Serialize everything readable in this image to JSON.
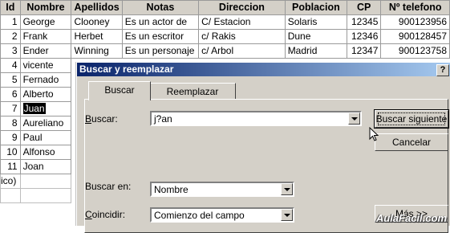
{
  "sheet": {
    "headers": [
      "Id",
      "Nombre",
      "Apellidos",
      "Notas",
      "Direccion",
      "Poblacion",
      "CP",
      "Nº telefono"
    ],
    "rows": [
      {
        "id": "1",
        "nombre": "George",
        "apellidos": "Clooney",
        "notas": "Es un actor de",
        "direccion": "C/ Estacion",
        "poblacion": "Solaris",
        "cp": "12345",
        "telefono": "900123956"
      },
      {
        "id": "2",
        "nombre": "Frank",
        "apellidos": "Herbet",
        "notas": "Es un escritor",
        "direccion": "c/ Rakis",
        "poblacion": "Dune",
        "cp": "12346",
        "telefono": "900128457"
      },
      {
        "id": "3",
        "nombre": "Ender",
        "apellidos": "Winning",
        "notas": "Es un personaje",
        "direccion": "c/ Arbol",
        "poblacion": "Madrid",
        "cp": "12347",
        "telefono": "900123758"
      },
      {
        "id": "4",
        "nombre": "vicente"
      },
      {
        "id": "5",
        "nombre": "Fernado"
      },
      {
        "id": "6",
        "nombre": "Alberto"
      },
      {
        "id": "7",
        "nombre": "Juan",
        "selected": true
      },
      {
        "id": "8",
        "nombre": "Aureliano"
      },
      {
        "id": "9",
        "nombre": "Paul"
      },
      {
        "id": "10",
        "nombre": "Alfonso"
      },
      {
        "id": "11",
        "nombre": "Joan"
      }
    ],
    "last_row_fragment": "ico)"
  },
  "dialog": {
    "title": "Buscar y reemplazar",
    "help": "?",
    "tabs": [
      "Buscar",
      "Reemplazar"
    ],
    "buscar_label_prefix": "",
    "buscar_label_ul": "B",
    "buscar_label_rest": "uscar:",
    "buscar_value": "j?an",
    "buscar_en_label": "Buscar en:",
    "buscar_en_value": "Nombre",
    "coincidir_label_ul": "C",
    "coincidir_label_rest": "oincidir:",
    "coincidir_value": "Comienzo del campo",
    "buttons": {
      "buscar_siguiente": "Buscar siguiente",
      "cancelar": "Cancelar",
      "mas": "Más >>"
    }
  },
  "watermark": "AulaFacil.com",
  "colors": {
    "titlebar_start": "#0a246a",
    "titlebar_end": "#a6caf0",
    "dialog_bg": "#d4d0c8"
  }
}
